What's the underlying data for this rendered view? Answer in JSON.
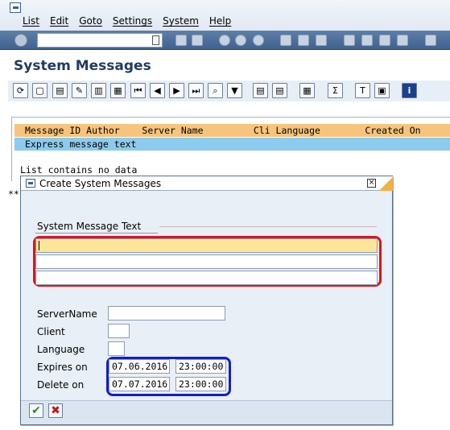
{
  "menu": [
    "List",
    "Edit",
    "Goto",
    "Settings",
    "System",
    "Help"
  ],
  "page_title": "System Messages",
  "list": {
    "header_row1": "Message ID Author    Server Name         Cli Language        Created On",
    "header_row2": "Express message text",
    "empty_text": "List contains no data",
    "stars": "**"
  },
  "dialog": {
    "title": "Create System Messages",
    "close_glyph": "×",
    "group_label": "System Message Text",
    "fields": {
      "server_label": "ServerName",
      "client_label": "Client",
      "language_label": "Language",
      "expires_label": "Expires on",
      "delete_label": "Delete on"
    },
    "values": {
      "expires_date": "07.06.2016",
      "expires_time": "23:00:00",
      "delete_date": "07.07.2016",
      "delete_time": "23:00:00"
    },
    "confirm_glyph": "✔",
    "cancel_glyph": "✖"
  },
  "colors": {
    "header_orange": "#f7c47d",
    "header_blue": "#8ccbed",
    "highlight_red": "#e0121b",
    "highlight_blue": "#1020c8"
  }
}
